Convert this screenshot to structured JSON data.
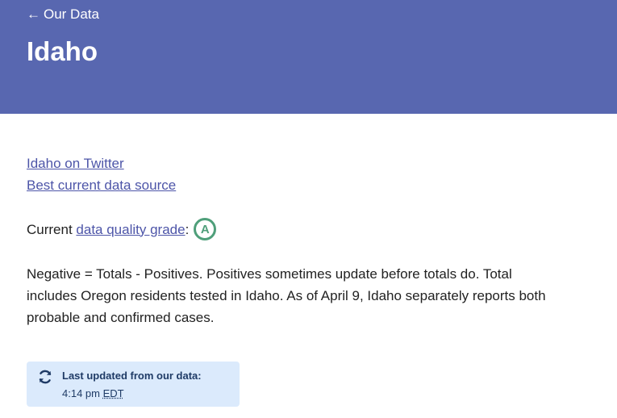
{
  "header": {
    "back_arrow": "←",
    "back_label": "Our Data",
    "title": "Idaho",
    "background_color": "#5867b0"
  },
  "links": {
    "twitter": "Idaho on Twitter",
    "data_source": "Best current data source"
  },
  "grade": {
    "prefix": "Current",
    "link_text": "data quality grade",
    "colon": ":",
    "value": "A",
    "color": "#4f9f7a"
  },
  "notes": "Negative = Totals - Positives. Positives sometimes update before totals do. Total includes Oregon residents tested in Idaho. As of April 9, Idaho separately reports both probable and confirmed cases.",
  "updated": {
    "icon": "refresh-icon",
    "title": "Last updated from our data:",
    "time": "4:14 pm",
    "timezone": "EDT"
  }
}
